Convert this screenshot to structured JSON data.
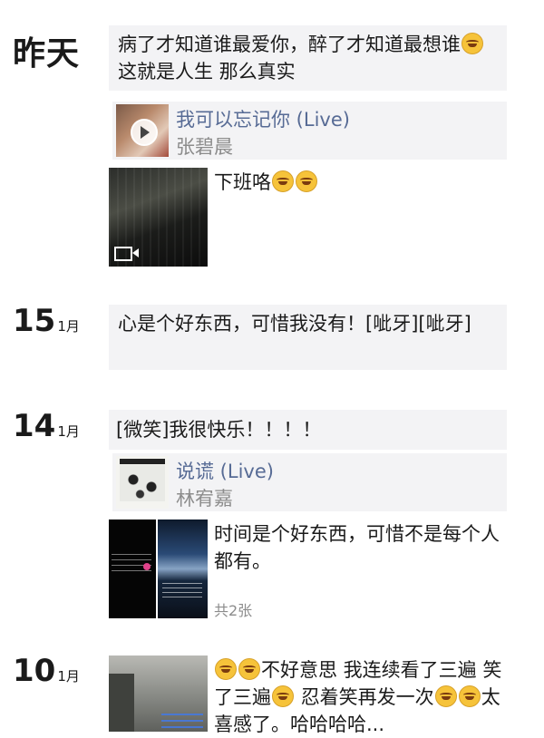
{
  "posts": [
    {
      "date": "昨天",
      "text": "病了才知道谁最爱你，醉了才知道最想谁",
      "text_tail": "这就是人生 那么真实",
      "music": {
        "title": "我可以忘记你 (Live)",
        "artist": "张碧晨",
        "icon": "play-icon"
      },
      "video_caption": "下班咯"
    },
    {
      "day": "15",
      "month": "1月",
      "text": "心是个好东西，可惜我没有！[呲牙][呲牙]"
    },
    {
      "day": "14",
      "month": "1月",
      "text": "[微笑]我很快乐！！！！",
      "music": {
        "title": "说谎 (Live)",
        "artist": "林宥嘉",
        "icon": "play-icon"
      },
      "photo_caption": "时间是个好东西，可惜不是每个人都有。",
      "photo_count": "共2张"
    },
    {
      "day": "10",
      "month": "1月",
      "text_a": "不好意思 我连续看了三遍 笑了三遍",
      "text_b": "忍着笑再发一次",
      "text_c": "太喜感了。哈哈哈哈..."
    }
  ],
  "colors": {
    "link": "#576b95",
    "secondary": "#8c8c8c",
    "card_bg": "#f3f3f5"
  }
}
